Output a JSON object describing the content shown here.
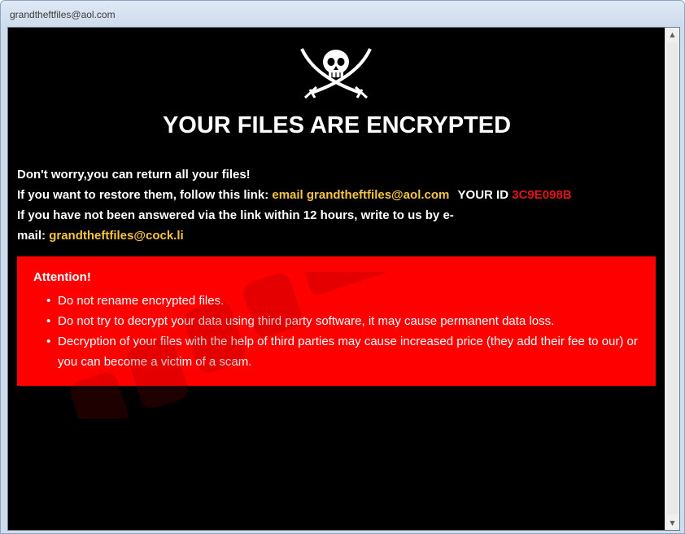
{
  "window": {
    "title": "grandtheftfiles@aol.com"
  },
  "icons": {
    "logo": "skull-crossed-swords-icon",
    "scroll_up": "triangle-up-icon",
    "scroll_down": "triangle-down-icon"
  },
  "note": {
    "heading": "YOUR FILES ARE ENCRYPTED",
    "line1": "Don't worry,you can return all your files!",
    "line2_prefix": "If you want to restore them, follow this link: ",
    "line2_email_label": "email grandtheftfiles@aol.com",
    "line2_id_label": "YOUR ID",
    "line2_id_value": "3C9E098B",
    "line3": "If you have not been answered via the link within 12 hours, write to us by e-",
    "line4_prefix": "mail: ",
    "line4_email": "grandtheftfiles@cock.li"
  },
  "attention": {
    "title": "Attention!",
    "items": [
      "Do not rename encrypted files.",
      "Do not try to decrypt your data using third party software, it may cause permanent data loss.",
      "Decryption of your files with the help of third parties may cause increased price (they add their fee to our) or you can become a victim of a scam."
    ]
  },
  "colors": {
    "background": "#000000",
    "accent_yellow": "#f5c542",
    "id_red": "#e0151b",
    "attention_bg": "#ff0000"
  }
}
